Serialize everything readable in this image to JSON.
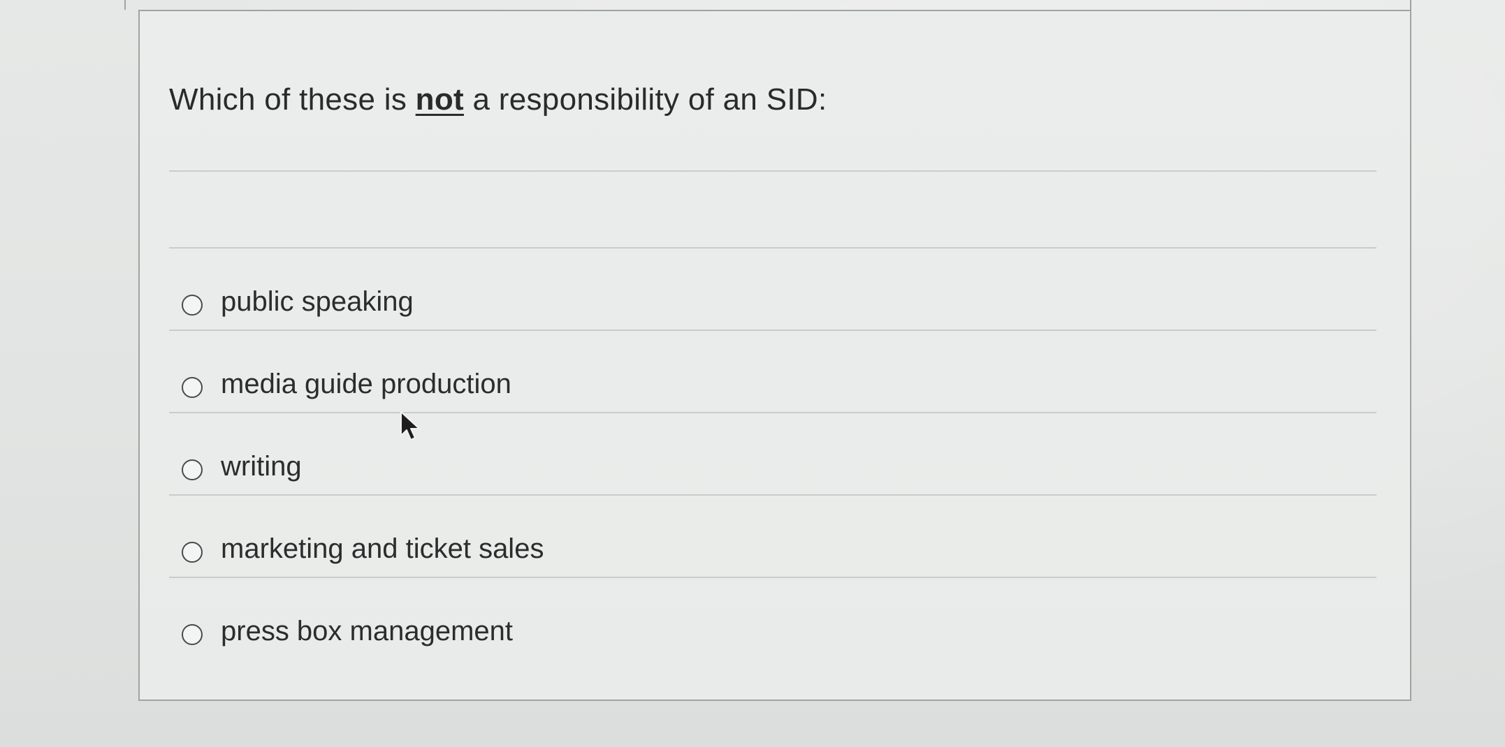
{
  "question": {
    "prompt_before": "Which of these is ",
    "prompt_emphasis": "not",
    "prompt_after": " a responsibility of an SID:"
  },
  "options": [
    {
      "label": "public speaking",
      "selected": false
    },
    {
      "label": "media guide production",
      "selected": false
    },
    {
      "label": "writing",
      "selected": false
    },
    {
      "label": "marketing and ticket sales",
      "selected": false
    },
    {
      "label": "press box management",
      "selected": false
    }
  ],
  "colors": {
    "background": "#e4e6e5",
    "border": "#9fa3a2",
    "text": "#2c2c2c",
    "divider": "#c9cccb"
  },
  "icons": {
    "radio": "radio-unchecked-icon",
    "pointer": "mouse-cursor-icon"
  }
}
